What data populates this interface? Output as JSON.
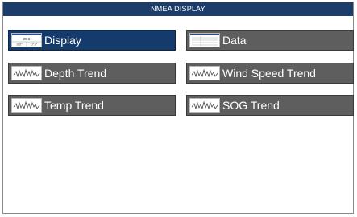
{
  "window": {
    "title": "NMEA DISPLAY"
  },
  "menu": {
    "items": [
      {
        "label": "Display",
        "icon": "display-thumbnail-icon",
        "selected": true
      },
      {
        "label": "Data",
        "icon": "data-table-icon",
        "selected": false
      },
      {
        "label": "Depth Trend",
        "icon": "trend-graph-icon",
        "selected": false
      },
      {
        "label": "Wind Speed Trend",
        "icon": "trend-graph-icon",
        "selected": false
      },
      {
        "label": "Temp Trend",
        "icon": "trend-graph-icon",
        "selected": false
      },
      {
        "label": "SOG Trend",
        "icon": "trend-graph-icon",
        "selected": false
      }
    ]
  },
  "thumbnail": {
    "display_value": "25.5",
    "display_left": "102°",
    "display_right": "17.5°"
  },
  "colors": {
    "title_bar": "#1c3d6a",
    "button": "#5e5e5e",
    "button_selected": "#143b6b",
    "text": "#ffffff"
  }
}
